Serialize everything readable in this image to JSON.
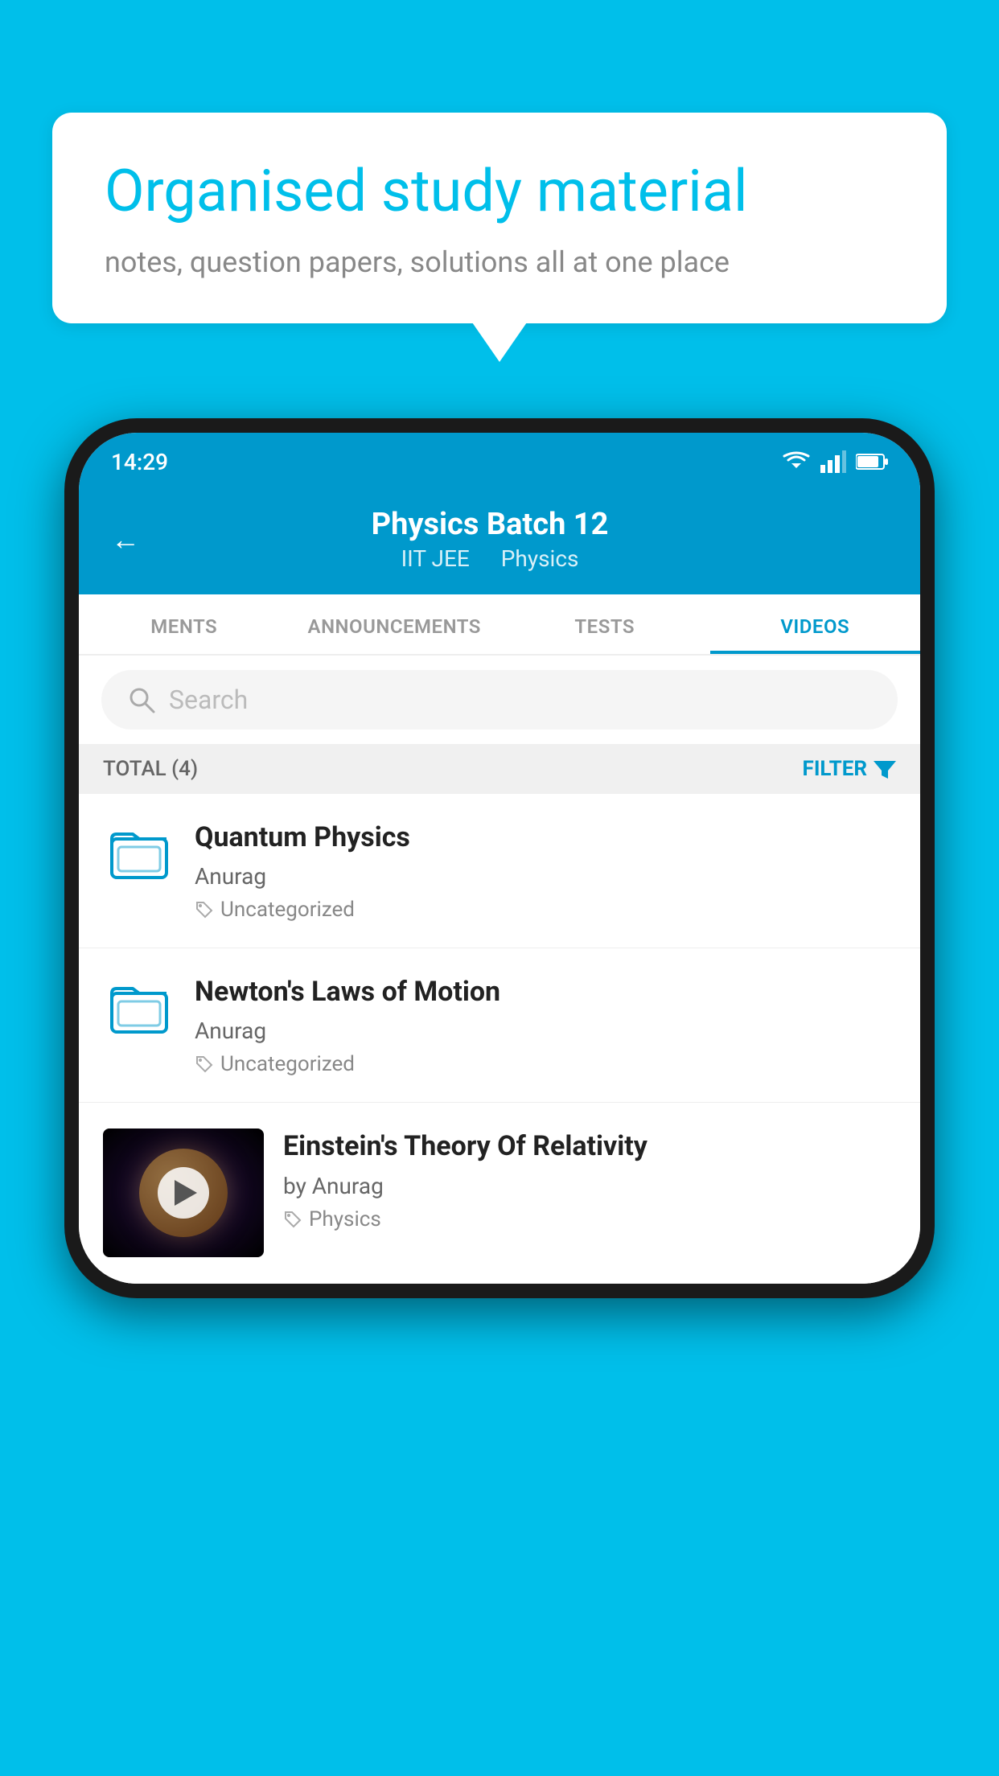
{
  "background_color": "#00BFEA",
  "speech_bubble": {
    "heading": "Organised study material",
    "subtext": "notes, question papers, solutions all at one place"
  },
  "status_bar": {
    "time": "14:29"
  },
  "app_header": {
    "back_label": "←",
    "title": "Physics Batch 12",
    "subtitle_part1": "IIT JEE",
    "subtitle_part2": "Physics"
  },
  "tabs": [
    {
      "label": "MENTS",
      "active": false
    },
    {
      "label": "ANNOUNCEMENTS",
      "active": false
    },
    {
      "label": "TESTS",
      "active": false
    },
    {
      "label": "VIDEOS",
      "active": true
    }
  ],
  "search": {
    "placeholder": "Search"
  },
  "filter_bar": {
    "total_label": "TOTAL (4)",
    "filter_label": "FILTER"
  },
  "videos": [
    {
      "title": "Quantum Physics",
      "author": "Anurag",
      "tag": "Uncategorized",
      "has_thumbnail": false
    },
    {
      "title": "Newton's Laws of Motion",
      "author": "Anurag",
      "tag": "Uncategorized",
      "has_thumbnail": false
    },
    {
      "title": "Einstein's Theory Of Relativity",
      "author": "by Anurag",
      "tag": "Physics",
      "has_thumbnail": true
    }
  ]
}
